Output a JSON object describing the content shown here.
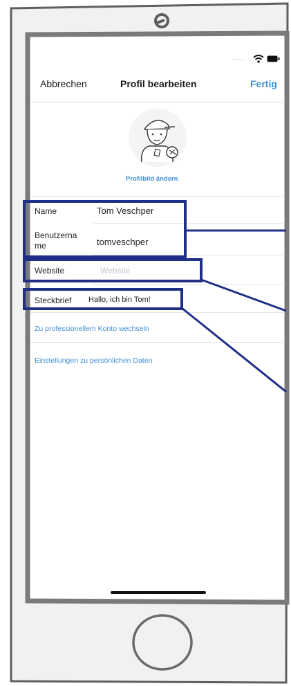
{
  "colors": {
    "accent": "#3f8fd6",
    "annotation_blue": "#1f2f86",
    "frame": "#6f6f6f"
  },
  "status_bar": {
    "signal": "....",
    "wifi_icon": "wifi-icon",
    "battery_icon": "battery-icon"
  },
  "nav": {
    "cancel": "Abbrechen",
    "title": "Profil bearbeiten",
    "done": "Fertig"
  },
  "profile": {
    "avatar_icon": "avatar-illustration",
    "change_photo": "Profilbild ändern"
  },
  "fields": [
    {
      "label": "Name",
      "value": "Tom Veschper"
    },
    {
      "label_line1": "Benutzerna",
      "label_line2": "me",
      "value": "tomveschper"
    },
    {
      "label": "Website",
      "placeholder": "Website"
    },
    {
      "label": "Steckbrief",
      "value": "Hallo, ich bin Tom!"
    }
  ],
  "links": [
    "Zu professionellem Konto wechseln",
    "Einstellungen zu persönlichen Daten"
  ]
}
